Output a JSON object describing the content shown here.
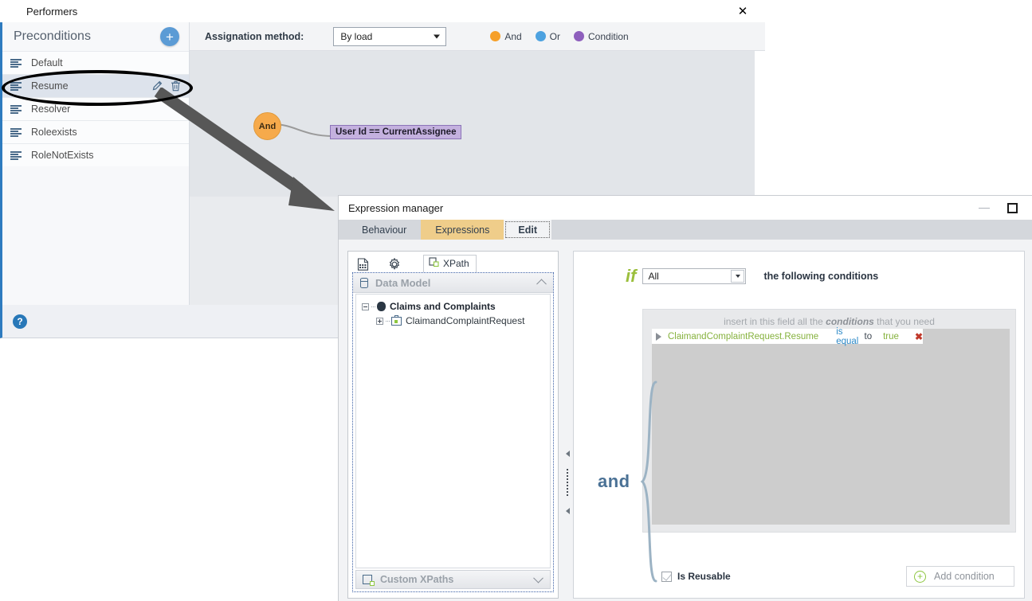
{
  "performers_window": {
    "title": "Performers",
    "app_icon": "hexagon-icon",
    "close_label": "✕",
    "preconditions": {
      "title": "Preconditions",
      "add_label": "+",
      "items": [
        {
          "label": "Default",
          "selected": false
        },
        {
          "label": "Resume",
          "selected": true
        },
        {
          "label": "Resolver",
          "selected": false
        },
        {
          "label": "Roleexists",
          "selected": false
        },
        {
          "label": "RoleNotExists",
          "selected": false
        }
      ],
      "row_actions": {
        "edit_icon": "pencil-icon",
        "delete_icon": "trash-icon"
      }
    },
    "toolbar": {
      "assignation_label": "Assignation method:",
      "assignation_value": "By load",
      "assignation_options": [
        "By load"
      ],
      "legend": [
        {
          "label": "And",
          "color": "#f6a02a"
        },
        {
          "label": "Or",
          "color": "#4da2e0"
        },
        {
          "label": "Condition",
          "color": "#8e5fbd"
        }
      ]
    },
    "graph": {
      "and_node_label": "And",
      "condition_node_label": "User Id == CurrentAssignee",
      "and_node_color": "#f6aa4b",
      "condition_node_color": "#c4b1df"
    },
    "footer": {
      "help_label": "?"
    }
  },
  "expression_manager": {
    "title": "Expression manager",
    "window_controls": {
      "minimize": "minimize-icon",
      "maximize": "maximize-icon"
    },
    "tabs": [
      {
        "label": "Behaviour",
        "state": "normal"
      },
      {
        "label": "Expressions",
        "state": "accent"
      },
      {
        "label": "Edit",
        "state": "active"
      }
    ],
    "tree_panel": {
      "toolbar_icons": [
        "document-grid-icon",
        "gear-icon"
      ],
      "xpath_tab_label": "XPath",
      "data_model_label": "Data Model",
      "nodes": [
        {
          "label": "Claims and Complaints",
          "level": 0,
          "expander": "minus"
        },
        {
          "label": "ClaimandComplaintRequest",
          "level": 1,
          "expander": "plus"
        }
      ],
      "custom_xpaths_label": "Custom XPaths"
    },
    "conditions_panel": {
      "if_label": "if",
      "scope_value": "All",
      "scope_options": [
        "All"
      ],
      "following_text": "the following conditions",
      "hint_prefix": "insert in this field all the",
      "hint_emphasis": "conditions",
      "hint_suffix": "that you need",
      "and_word": "and",
      "rows": [
        {
          "field": "ClaimandComplaintRequest.Resume",
          "operator": "is equal",
          "to": "to",
          "value": "true",
          "delete_label": "✖"
        }
      ],
      "is_reusable_label": "Is Reusable",
      "is_reusable_checked": true,
      "add_condition_label": "Add condition",
      "add_condition_plus": "+"
    }
  },
  "annotations": {
    "highlight_target": "Resume",
    "arrow": "pointer-arrow"
  }
}
